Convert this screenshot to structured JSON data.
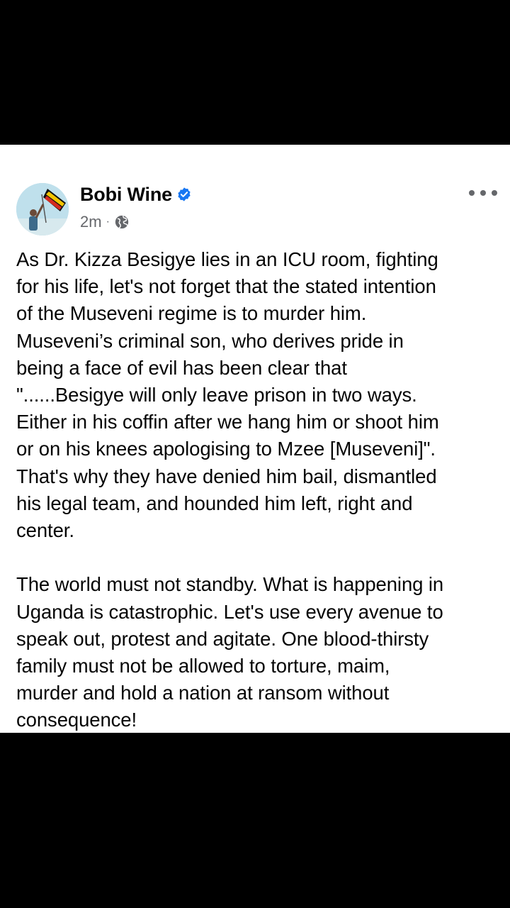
{
  "post": {
    "author": "Bobi Wine",
    "timestamp": "2m",
    "separator": "·",
    "paragraphs": [
      "As Dr. Kizza Besigye lies in an ICU room, fighting\nfor his life, let's not forget that the stated intention\nof the Museveni regime is to murder him.\nMuseveni’s criminal son, who derives pride in\nbeing a face of evil has been clear that\n\"......Besigye will only leave prison in two ways.\nEither in his coffin after we hang him or shoot him\nor on his knees apologising to Mzee [Museveni]\".\nThat's why they have denied him bail, dismantled\nhis legal team, and hounded him left, right and\ncenter.",
      "The world must not standby. What is happening in\nUganda is catastrophic. Let's use every avenue to\nspeak out, protest and agitate. One blood-thirsty\nfamily must not be allowed to torture, maim,\nmurder and hold a nation at ransom without\nconsequence!"
    ]
  },
  "icons": {
    "verified": "verified-badge-icon",
    "audience": "globe-icon",
    "more": "more-options-icon"
  },
  "colors": {
    "background": "#000000",
    "card": "#ffffff",
    "text": "#050505",
    "secondary_text": "#65676b",
    "verified_blue": "#1877f2"
  }
}
